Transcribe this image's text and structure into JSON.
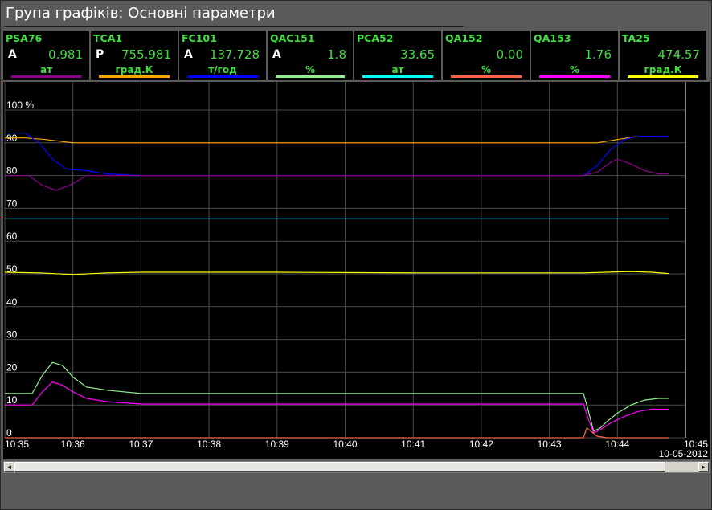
{
  "window": {
    "title": "Група графіків: Основні параметри"
  },
  "params": [
    {
      "tag": "PSA76",
      "mode": "A",
      "value": "0.981",
      "unit": "ат",
      "color": "#8b008b"
    },
    {
      "tag": "TCA1",
      "mode": "P",
      "value": "755.981",
      "unit": "град.К",
      "color": "#ffa500"
    },
    {
      "tag": "FC101",
      "mode": "A",
      "value": "137.728",
      "unit": "т/год",
      "color": "#0000ff"
    },
    {
      "tag": "QAC151",
      "mode": "A",
      "value": "1.8",
      "unit": "%",
      "color": "#90ee90"
    },
    {
      "tag": "PCA52",
      "mode": "",
      "value": "33.65",
      "unit": "ат",
      "color": "#00ffff"
    },
    {
      "tag": "QA152",
      "mode": "",
      "value": "0.00",
      "unit": "%",
      "color": "#ff6347"
    },
    {
      "tag": "QA153",
      "mode": "",
      "value": "1.76",
      "unit": "%",
      "color": "#ff00ff"
    },
    {
      "tag": "TA25",
      "mode": "",
      "value": "474.57",
      "unit": "град.К",
      "color": "#ffff00"
    }
  ],
  "chart_data": {
    "type": "line",
    "ylabel": "%",
    "y_ticks": [
      "100 %",
      "90",
      "80",
      "70",
      "60",
      "50",
      "40",
      "30",
      "20",
      "10",
      "0"
    ],
    "ylim": [
      0,
      100
    ],
    "x_ticks": [
      "10:35",
      "10:36",
      "10:37",
      "10:38",
      "10:39",
      "10:40",
      "10:41",
      "10:42",
      "10:43",
      "10:44",
      "10:45"
    ],
    "date": "10-05-2012",
    "grid": true,
    "series": [
      {
        "name": "TCA1",
        "color": "#ffa500",
        "x": [
          0,
          0.3,
          0.6,
          1.0,
          2,
          4,
          6,
          8,
          8.5,
          8.7,
          9.0,
          9.3,
          9.6,
          9.75
        ],
        "y": [
          91.5,
          91.5,
          91,
          90,
          90,
          90,
          90,
          90,
          90,
          90,
          91,
          92,
          92,
          92
        ]
      },
      {
        "name": "FC101",
        "color": "#0000ff",
        "x": [
          0,
          0.3,
          0.5,
          0.7,
          0.9,
          1.2,
          1.5,
          2,
          4,
          6,
          8.5,
          8.7,
          8.9,
          9.1,
          9.3,
          9.6,
          9.75
        ],
        "y": [
          93,
          93,
          90,
          85,
          82,
          81.5,
          80.5,
          80,
          80,
          80,
          80,
          83,
          88,
          91,
          92,
          92,
          92
        ]
      },
      {
        "name": "PSA76",
        "color": "#8b008b",
        "x": [
          0,
          0.35,
          0.55,
          0.75,
          0.95,
          1.2,
          1.5,
          2,
          4,
          6,
          8.5,
          8.7,
          8.9,
          9.0,
          9.2,
          9.4,
          9.6,
          9.75
        ],
        "y": [
          80,
          80,
          77,
          75.5,
          77,
          80,
          80,
          80,
          80,
          80,
          80,
          81,
          84,
          85,
          83.5,
          81.5,
          80.5,
          80.5
        ]
      },
      {
        "name": "PCA52",
        "color": "#00ffff",
        "x": [
          0,
          9.75
        ],
        "y": [
          67,
          67
        ]
      },
      {
        "name": "TA25",
        "color": "#ffff00",
        "x": [
          0,
          0.5,
          1,
          1.5,
          2,
          4,
          6,
          8.5,
          9.2,
          9.5,
          9.75
        ],
        "y": [
          50.5,
          50.3,
          49.8,
          50.3,
          50.5,
          50.5,
          50.3,
          50.3,
          50.7,
          50.5,
          50.1
        ]
      },
      {
        "name": "QAC151",
        "color": "#90ee90",
        "x": [
          0,
          0.4,
          0.55,
          0.7,
          0.85,
          1.0,
          1.2,
          1.5,
          2,
          4,
          6,
          8.5,
          8.55,
          8.65,
          8.75,
          8.85,
          9.0,
          9.2,
          9.4,
          9.6,
          9.75
        ],
        "y": [
          13.5,
          13.5,
          19,
          23,
          22,
          18.5,
          15.5,
          14.5,
          13.5,
          13.5,
          13.5,
          13.5,
          10,
          2,
          3,
          5,
          7.5,
          10,
          11.5,
          12,
          12
        ]
      },
      {
        "name": "QA153",
        "color": "#ff00ff",
        "x": [
          0,
          0.4,
          0.55,
          0.7,
          0.85,
          1.0,
          1.2,
          1.5,
          2,
          4,
          6,
          8.5,
          8.55,
          8.65,
          8.75,
          8.9,
          9.1,
          9.3,
          9.5,
          9.75
        ],
        "y": [
          10,
          10,
          14,
          17,
          16,
          14,
          12,
          11,
          10.3,
          10.3,
          10.3,
          10.3,
          7,
          1.5,
          2.5,
          4.5,
          6.5,
          8,
          8.7,
          8.7
        ]
      },
      {
        "name": "QA152",
        "color": "#ff6347",
        "x": [
          0,
          8.5,
          8.55,
          8.7,
          8.85,
          9.0,
          9.75
        ],
        "y": [
          0,
          0,
          3,
          0.5,
          0,
          0,
          0
        ]
      }
    ]
  },
  "scrollbar": {
    "left_arrow": "◄",
    "right_arrow": "►"
  }
}
